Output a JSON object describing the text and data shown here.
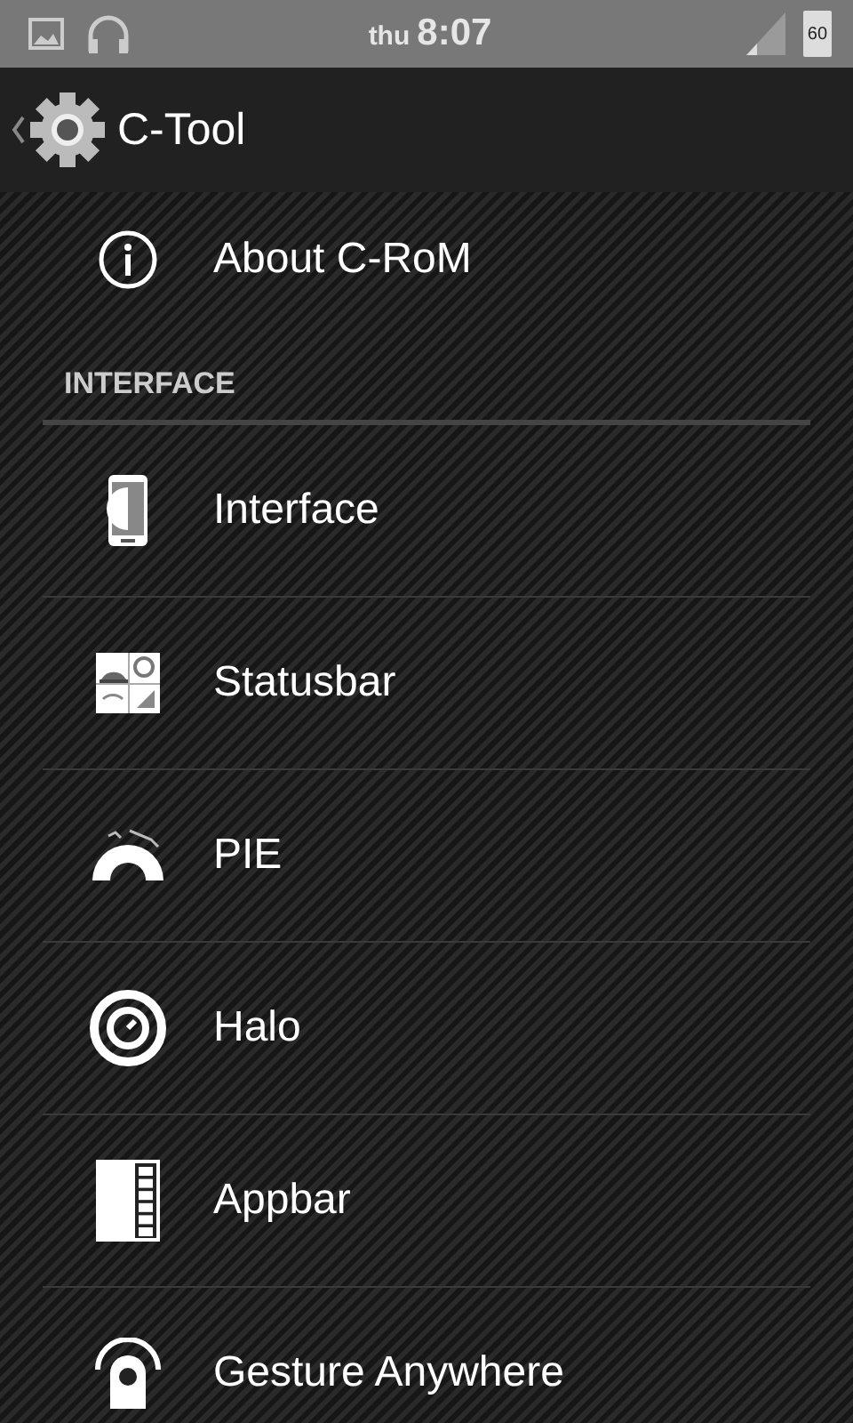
{
  "status_bar": {
    "day": "thu",
    "time": "8:07",
    "battery": "60"
  },
  "action_bar": {
    "title": "C-Tool"
  },
  "top_items": [
    {
      "label": "About C-RoM",
      "kind": "info"
    }
  ],
  "section": {
    "title": "INTERFACE"
  },
  "items": [
    {
      "label": "Interface",
      "kind": "phone"
    },
    {
      "label": "Statusbar",
      "kind": "statusbar"
    },
    {
      "label": "PIE",
      "kind": "pie"
    },
    {
      "label": "Halo",
      "kind": "halo"
    },
    {
      "label": "Appbar",
      "kind": "appbar"
    },
    {
      "label": "Gesture Anywhere",
      "kind": "gesture"
    }
  ]
}
